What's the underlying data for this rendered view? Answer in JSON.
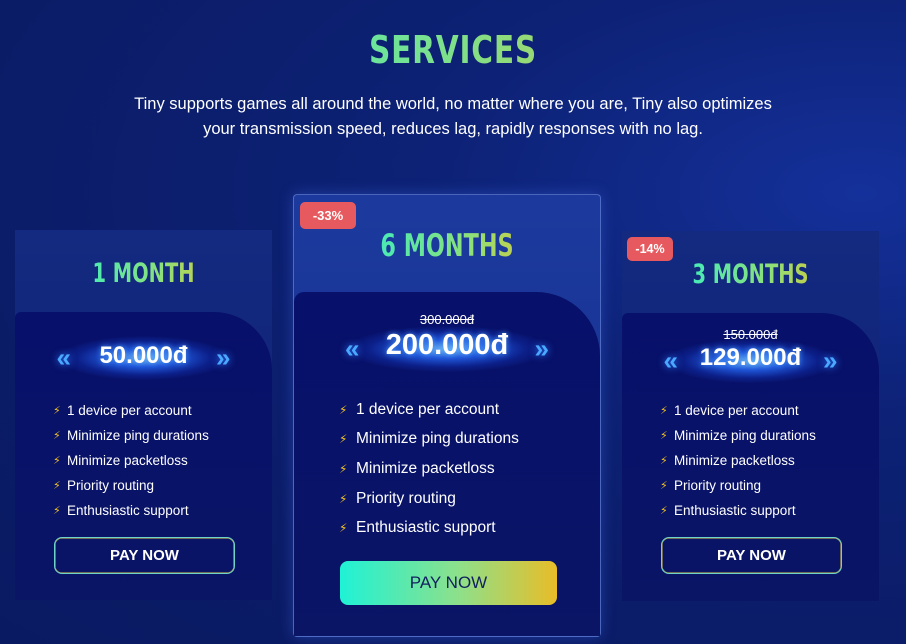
{
  "header": {
    "title": "SERVICES",
    "subtitle_line1": "Tiny supports games all around the world, no matter where you are, Tiny also optimizes",
    "subtitle_line2": "your transmission speed, reduces lag, rapidly responses with no lag."
  },
  "plans": [
    {
      "name": "1 MONTH",
      "price": "50.000đ",
      "features": [
        "1 device per account",
        "Minimize ping durations",
        "Minimize packetloss",
        "Priority routing",
        "Enthusiastic support"
      ],
      "cta": "PAY NOW"
    },
    {
      "name": "6 MONTHS",
      "discount": "-33%",
      "old_price": "300.000đ",
      "price": "200.000đ",
      "features": [
        "1 device per account",
        "Minimize ping durations",
        "Minimize packetloss",
        "Priority routing",
        "Enthusiastic support"
      ],
      "cta": "PAY NOW"
    },
    {
      "name": "3 MONTHS",
      "discount": "-14%",
      "old_price": "150.000đ",
      "price": "129.000đ",
      "features": [
        "1 device per account",
        "Minimize ping durations",
        "Minimize packetloss",
        "Priority routing",
        "Enthusiastic support"
      ],
      "cta": "PAY NOW"
    }
  ],
  "icons": {
    "feature": "lightning-bolt-icon",
    "price_glow": "chevron-glow-icon"
  },
  "colors": {
    "accent_start": "#1ff2d6",
    "accent_end": "#e8bd28",
    "badge": "#e65a5f",
    "background": "#0b1c68"
  }
}
